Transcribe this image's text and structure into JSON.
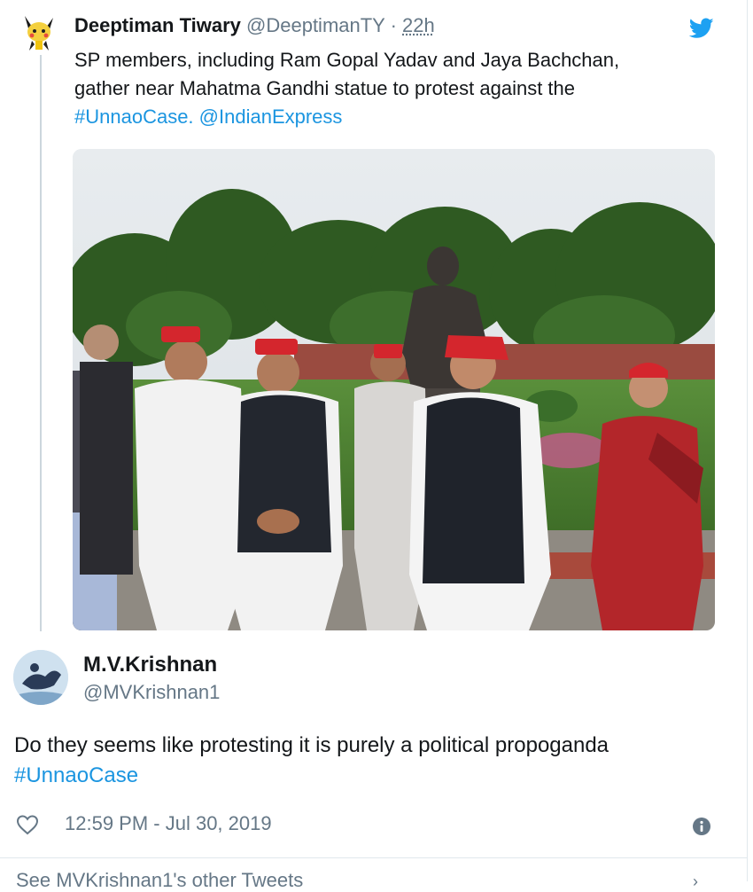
{
  "parent_tweet": {
    "author_name": "Deeptiman Tiwary",
    "author_handle": "@DeeptimanTY",
    "separator": "·",
    "relative_time": "22h",
    "text_line_1": "SP members, including Ram Gopal Yadav and Jaya Bachchan,",
    "text_line_2": "gather near Mahatma Gandhi statue to protest against the",
    "hashtag": "#UnnaoCase.",
    "mention": "@IndianExpress",
    "icons": {
      "avatar": "pikachu-avatar",
      "brand": "twitter-bird-icon"
    },
    "colors": {
      "link": "#1b95e0",
      "brand": "#1da1f2"
    }
  },
  "reply_tweet": {
    "author_name": "M.V.Krishnan",
    "author_handle": "@MVKrishnan1",
    "text": "Do they seems like protesting it is purely a political propoganda",
    "hashtag": "#UnnaoCase",
    "timestamp": "12:59 PM - Jul 30, 2019",
    "icons": {
      "like": "heart-icon",
      "info": "info-icon"
    }
  },
  "footer": {
    "more_link": "See MVKrishnan1's other Tweets",
    "chevron": "›"
  }
}
